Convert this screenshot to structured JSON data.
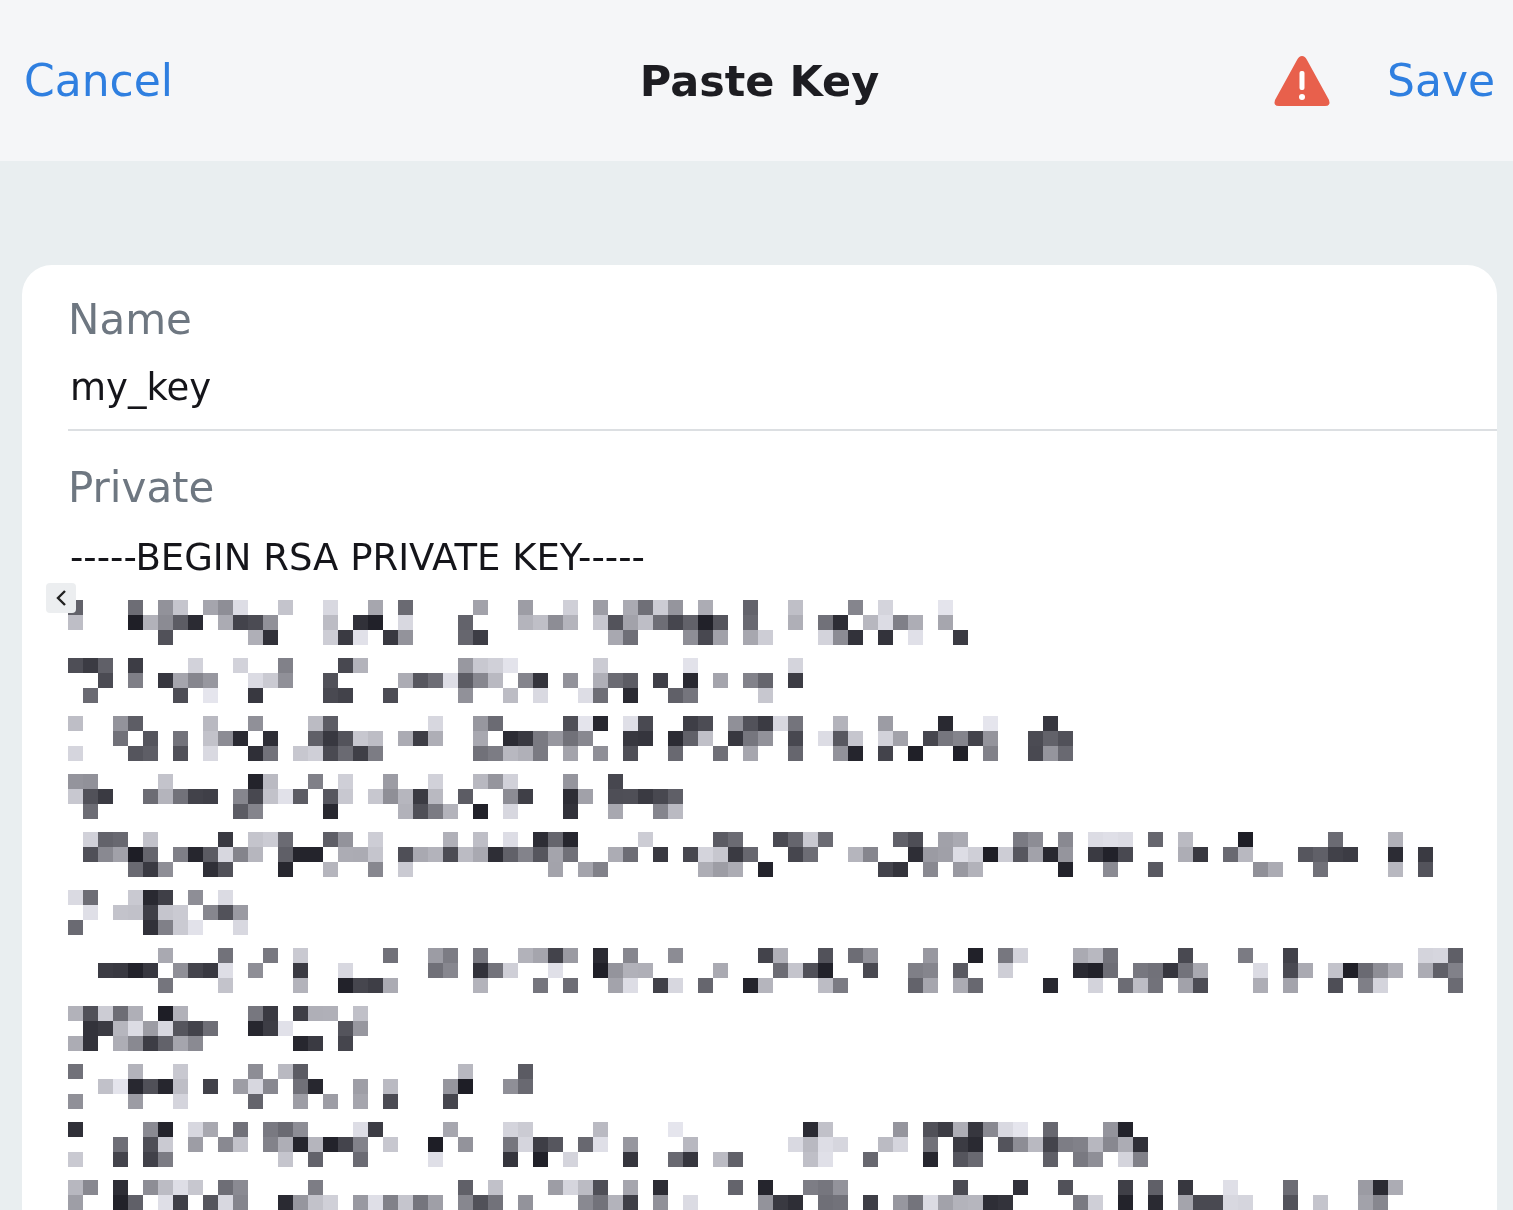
{
  "nav": {
    "cancel": "Cancel",
    "title": "Paste Key",
    "save": "Save"
  },
  "fields": [
    {
      "kind": "text",
      "label": "Name",
      "value": "my_key"
    },
    {
      "kind": "key",
      "label": "Private",
      "value": "-----BEGIN RSA PRIVATE KEY-----"
    }
  ]
}
